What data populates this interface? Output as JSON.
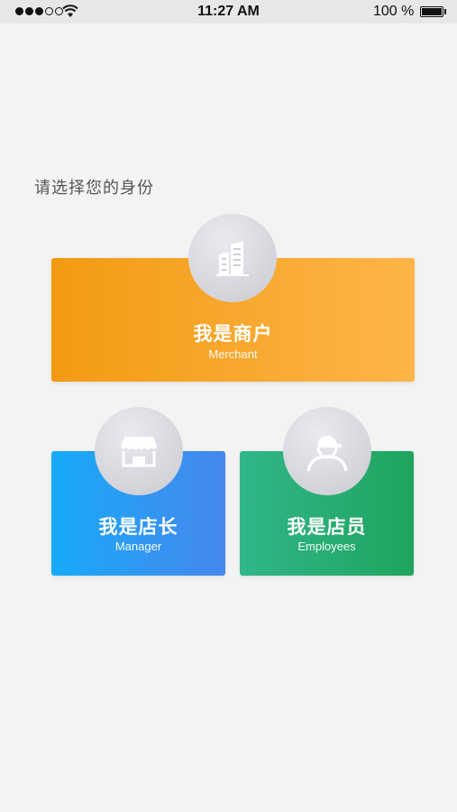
{
  "status_bar": {
    "time": "11:27 AM",
    "battery_percent": "100 %",
    "signal_bars_filled": 3,
    "signal_bars_total": 5
  },
  "prompt": "请选择您的身份",
  "roles": {
    "merchant": {
      "title": "我是商户",
      "subtitle": "Merchant",
      "icon": "building-icon",
      "color_start": "#f39a12",
      "color_end": "#fdb548"
    },
    "manager": {
      "title": "我是店长",
      "subtitle": "Manager",
      "icon": "storefront-icon",
      "color_start": "#17aaf8",
      "color_end": "#4787ec"
    },
    "employee": {
      "title": "我是店员",
      "subtitle": "Employees",
      "icon": "person-cap-icon",
      "color_start": "#31b689",
      "color_end": "#1fa45e"
    }
  }
}
